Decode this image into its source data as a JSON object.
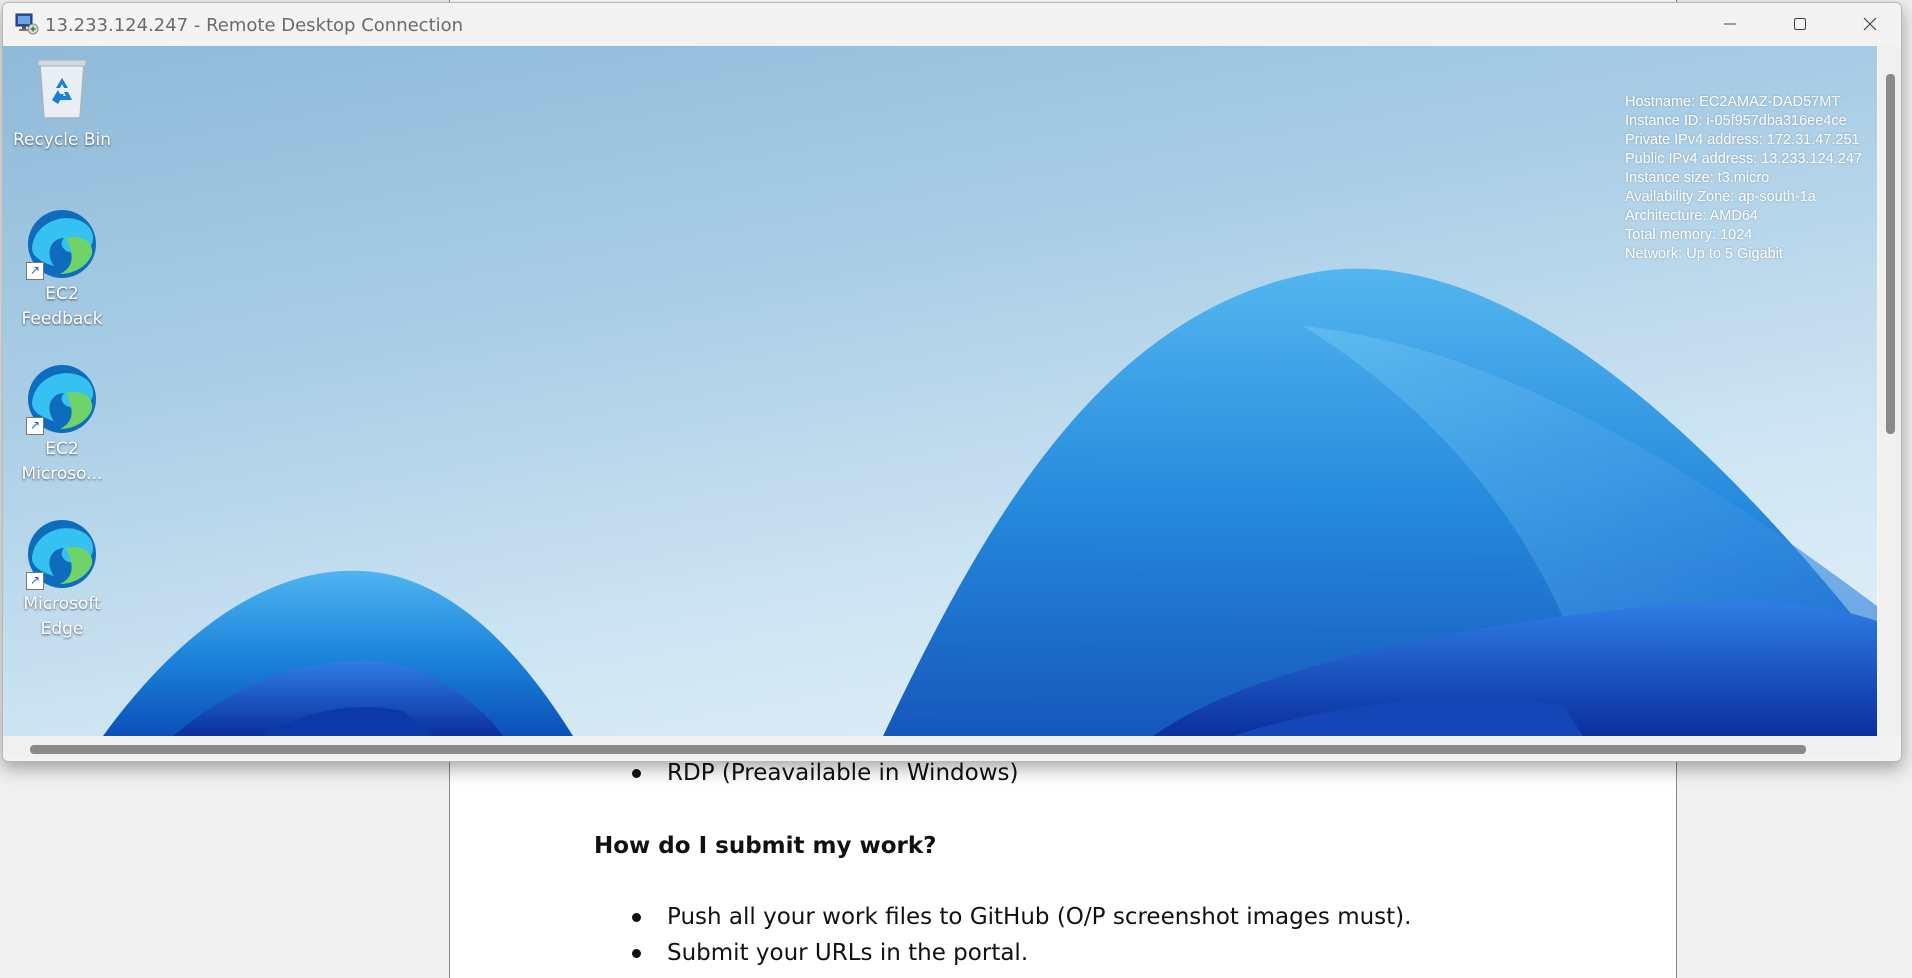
{
  "window": {
    "title": "13.233.124.247 - Remote Desktop Connection"
  },
  "desktop_icons": [
    {
      "label": "Recycle Bin",
      "icon": "recycle-bin-icon"
    },
    {
      "label": "EC2 Feedback",
      "icon": "edge-icon"
    },
    {
      "label": "EC2 Microso...",
      "icon": "edge-icon"
    },
    {
      "label": "Microsoft Edge",
      "icon": "edge-icon"
    }
  ],
  "bginfo": [
    "Hostname: EC2AMAZ-DAD57MT",
    "Instance ID: i-05f957dba316ee4ce",
    "Private IPv4 address: 172.31.47.251",
    "Public IPv4 address: 13.233.124.247",
    "Instance size: t3.micro",
    "Availability Zone: ap-south-1a",
    "Architecture: AMD64",
    "Total memory: 1024",
    "Network: Up to 5 Gigabit"
  ],
  "document": {
    "bullet_rdp": "RDP (Preavailable in Windows)",
    "heading": "How do I submit my work?",
    "bullet_push": "Push all your work files to GitHub (O/P screenshot images must).",
    "bullet_submit": "Submit your URLs in the portal."
  },
  "colors": {
    "wallpaper_blue": "#1e88e5",
    "bginfo_text": "#ffffff"
  }
}
